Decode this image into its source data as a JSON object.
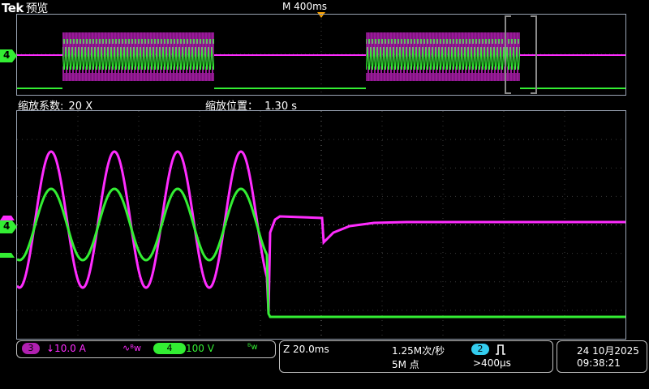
{
  "header": {
    "brand": "Tek",
    "mode": "预览",
    "timebase": "M 400ms"
  },
  "overview": {
    "channel_label": "4"
  },
  "zoom_info": {
    "factor_label": "缩放系数:",
    "factor_value": "20 X",
    "position_label": "缩放位置：",
    "position_value": "1.30 s"
  },
  "main": {
    "channel_label": "4"
  },
  "status": {
    "ch3": {
      "num": "3",
      "scale": "↓10.0 A",
      "coupling": "∿ᴮw"
    },
    "ch4": {
      "num": "4",
      "scale": "100 V",
      "coupling": "ᴮw"
    },
    "zoom_scale": "Z 20.0ms",
    "sample_rate": "1.25M次/秒",
    "record_length": "5M 点",
    "trigger_channel": "2",
    "trigger_icon": "trigger-rising-pulse",
    "trigger_value": ">400µs",
    "date": "24 10月2025",
    "time": "09:38:21"
  },
  "colors": {
    "ch3": "#ff2cff",
    "ch4": "#33ee33",
    "trigger": "#33ccee",
    "marker": "#ffa500"
  }
}
